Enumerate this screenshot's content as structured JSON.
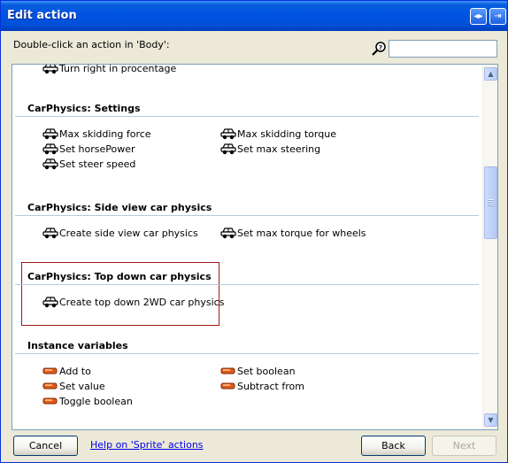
{
  "window": {
    "title": "Edit action",
    "title_buttons": [
      "restore-icon",
      "exit-icon"
    ]
  },
  "instruction": "Double-click an action in 'Body':",
  "search": {
    "value": "",
    "placeholder": ""
  },
  "list": {
    "partial_top_item": "Turn right in procentage",
    "sections": [
      {
        "title": "CarPhysics: Settings",
        "items": [
          {
            "label": "Max skidding force",
            "icon": "car-icon"
          },
          {
            "label": "Max skidding torque",
            "icon": "car-icon"
          },
          {
            "label": "Set horsePower",
            "icon": "car-icon"
          },
          {
            "label": "Set max steering",
            "icon": "car-icon"
          },
          {
            "label": "Set steer speed",
            "icon": "car-icon"
          }
        ]
      },
      {
        "title": "CarPhysics: Side view car physics",
        "items": [
          {
            "label": "Create side view car physics",
            "icon": "car-icon"
          },
          {
            "label": "Set max torque for wheels",
            "icon": "car-icon"
          }
        ]
      },
      {
        "title": "CarPhysics: Top down car physics",
        "highlighted": true,
        "items": [
          {
            "label": "Create top down 2WD car physics",
            "icon": "car-icon"
          }
        ]
      },
      {
        "title": "Instance variables",
        "items": [
          {
            "label": "Add to",
            "icon": "variable-icon"
          },
          {
            "label": "Set boolean",
            "icon": "variable-icon"
          },
          {
            "label": "Set value",
            "icon": "variable-icon"
          },
          {
            "label": "Subtract from",
            "icon": "variable-icon"
          },
          {
            "label": "Toggle boolean",
            "icon": "variable-icon"
          }
        ]
      }
    ]
  },
  "footer": {
    "cancel_label": "Cancel",
    "help_link": "Help on 'Sprite' actions",
    "back_label": "Back",
    "next_label": "Next"
  },
  "colors": {
    "titlebar": "#0054e3",
    "dialog_bg": "#ece9d8",
    "highlight_border": "#a01818",
    "link": "#0000ee"
  }
}
